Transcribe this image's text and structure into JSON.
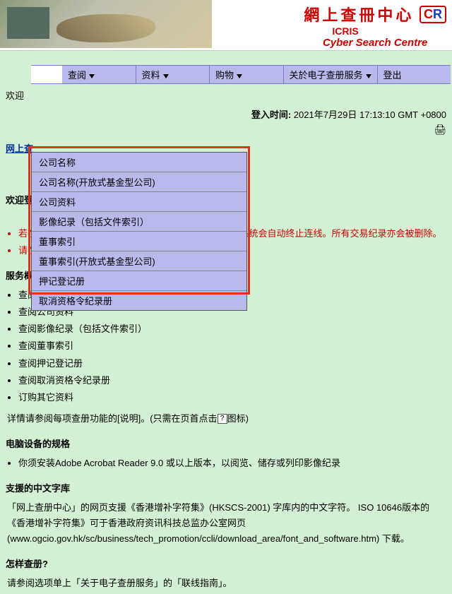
{
  "brand": {
    "cn": "網上查冊中心",
    "cr_c": "C",
    "cr_r": "R",
    "en1": "ICRIS",
    "en2": "Cyber Search Centre"
  },
  "menu": {
    "items": [
      {
        "label": "查阅",
        "arrow": true
      },
      {
        "label": "资料",
        "arrow": true
      },
      {
        "label": "购物",
        "arrow": true
      },
      {
        "label": "关於电子查册服务",
        "arrow": true
      },
      {
        "label": "登出",
        "arrow": false
      }
    ]
  },
  "dropdown": {
    "items": [
      "公司名称",
      "公司名称(开放式基金型公司)",
      "公司资料",
      "影像纪录（包括文件索引）",
      "董事索引",
      "董事索引(开放式基金型公司)",
      "押记登记册",
      "取消资格令纪录册"
    ]
  },
  "login": {
    "welcome": "欢迎",
    "time_label": "登入时间:",
    "time_value": "2021年7月29日 17:13:10 GMT +0800"
  },
  "page": {
    "breadcrumb": "网上查",
    "welcome_heading": "欢迎登",
    "red_notes": [
      "若在登入时段内连续20分钟未有作出任何查册动作，本系统会自动终止连线。所有交易纪录亦会被删除。",
      "请在离开前注销本网页。"
    ],
    "svc_heading": "服务概览",
    "svc_items": [
      "查阅公司名称",
      "查阅公司资料",
      "查阅影像纪录（包括文件索引）",
      "查阅董事索引",
      "查阅押记登记册",
      "查阅取消资格令纪录册",
      "订购其它资料"
    ],
    "svc_note_a": "详情请参阅每项查册功能的[说明]。(只需在页首点击",
    "svc_note_b": "图标)",
    "spec_heading": "电脑设备的规格",
    "spec_item": "你须安装Adobe Acrobat Reader 9.0 或以上版本，以阅览、储存或列印影像纪录",
    "font_heading": "支援的中文字库",
    "font_para": "「网上查册中心」的网页支援《香港增补字符集》(HKSCS-2001) 字库内的中文字符。 ISO 10646版本的《香港增补字符集》可于香港政府资讯科技总监办公室网页 (www.ogcio.gov.hk/sc/business/tech_promotion/ccli/download_area/font_and_software.htm) 下载。",
    "howto_heading": "怎样查册?",
    "howto_para": "请参阅选项单上「关于电子查册服务」的「联线指南」。"
  }
}
